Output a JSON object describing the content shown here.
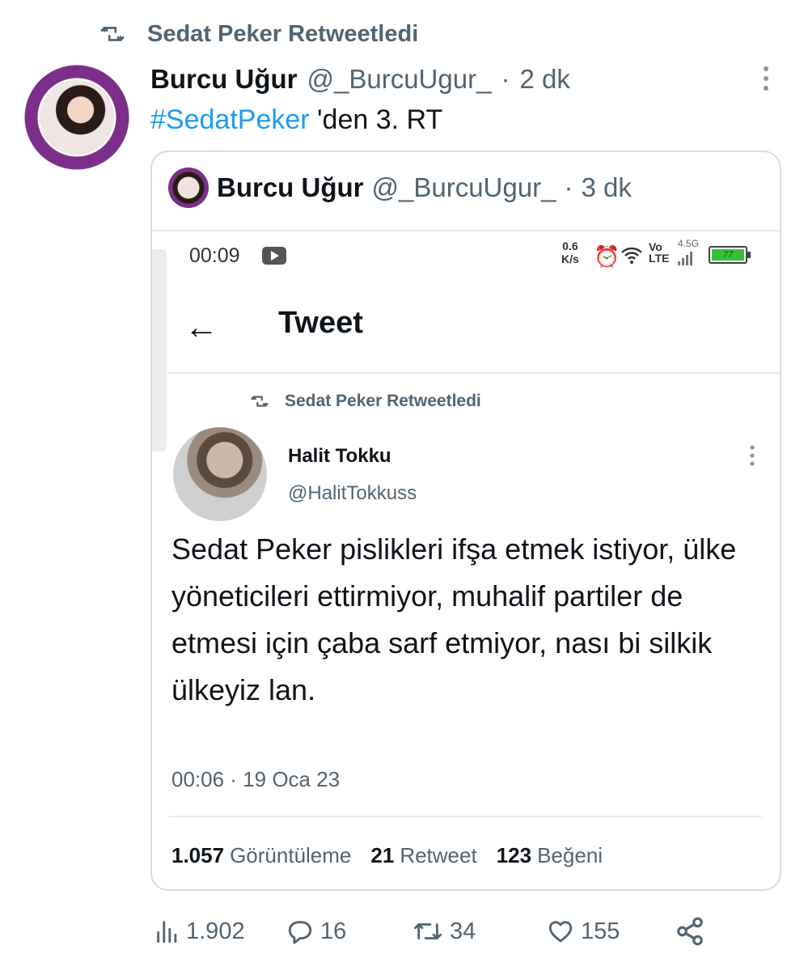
{
  "retweet_header": {
    "text": "Sedat Peker Retweetledi"
  },
  "tweet": {
    "author_name": "Burcu Uğur",
    "author_handle": "@_BurcuUgur_",
    "separator": "·",
    "time": "2 dk",
    "hashtag": "#SedatPeker",
    "text_rest": " 'den 3. RT"
  },
  "quoted": {
    "author_name": "Burcu Uğur",
    "author_handle": "@_BurcuUgur_",
    "separator": "·",
    "time": "3 dk",
    "screenshot": {
      "status_bar": {
        "clock": "00:09",
        "speed_value": "0.6",
        "speed_unit": "K/s",
        "volte_top": "Vo",
        "volte_bottom": "LTE",
        "network": "4.5G",
        "battery_level": "77"
      },
      "page_title": "Tweet",
      "retweet_header": "Sedat Peker Retweetledi",
      "author_name": "Halit Tokku",
      "author_handle": "@HalitTokkuss",
      "text": "Sedat Peker pislikleri ifşa etmek istiyor, ülke yöneticileri ettirmiyor, muhalif partiler de etmesi için çaba sarf etmiyor, nası bi silkik ülkeyiz lan.",
      "timestamp": "00:06 · 19 Oca 23",
      "stats": {
        "views_count": "1.057",
        "views_label": "Görüntüleme",
        "retweets_count": "21",
        "retweets_label": "Retweet",
        "likes_count": "123",
        "likes_label": "Beğeni"
      }
    }
  },
  "actions": {
    "views": "1.902",
    "replies": "16",
    "retweets": "34",
    "likes": "155"
  },
  "colors": {
    "link": "#1d9bf0",
    "muted": "#536471",
    "text": "#0f1419",
    "avatar_ring": "#7b2f8a"
  }
}
